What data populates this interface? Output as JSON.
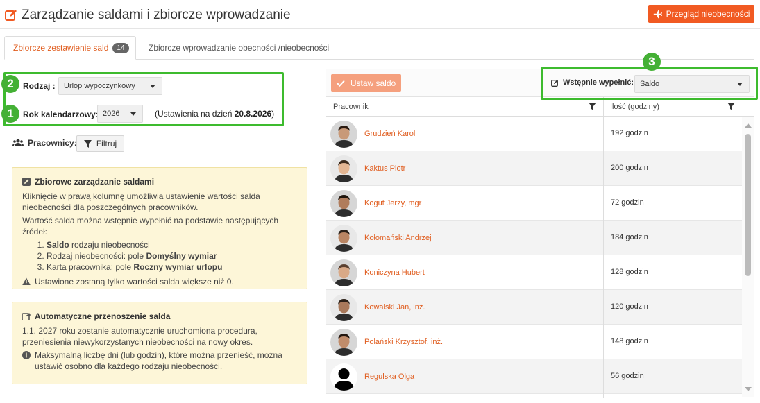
{
  "header": {
    "title": "Zarządzanie saldami i zbiorcze wprowadzanie",
    "absences_button": "Przegląd nieobecności"
  },
  "tabs": [
    {
      "label": "Zbiorcze zestawienie sald",
      "badge": "14",
      "active": true
    },
    {
      "label": "Zbiorcze wprowadzanie obecności /nieobecności",
      "active": false
    }
  ],
  "markers": [
    "1",
    "2",
    "3"
  ],
  "filters": {
    "type_label": "Rodzaj :",
    "type_value": "Urlop wypoczynkowy",
    "year_label": "Rok kalendarzowy:",
    "year_value": "2026",
    "settings_prefix": "(Ustawienia na dzień ",
    "settings_date": "20.8.2026",
    "settings_suffix": ")"
  },
  "workers": {
    "label": "Pracownicy:",
    "filter_button": "Filtruj"
  },
  "info_saldo": {
    "title": "Zbiorowe zarządzanie saldami",
    "p1": "Kliknięcie w prawą kolumnę umożliwia ustawienie wartości salda nieobecności dla poszczególnych pracowników.",
    "p2": "Wartość salda można wstępnie wypełnić na podstawie następujących źródeł:",
    "items": [
      {
        "bold": "Saldo",
        "pre": "",
        "post": " rodzaju nieobecności"
      },
      {
        "pre": "Rodzaj nieobecności: pole ",
        "bold": "Domyślny wymiar",
        "post": ""
      },
      {
        "pre": "Karta pracownika: pole ",
        "bold": "Roczny wymiar urlopu",
        "post": ""
      }
    ],
    "warning": "Ustawione zostaną tylko wartości salda większe niż 0."
  },
  "info_transfer": {
    "title": "Automatyczne przenoszenie salda",
    "p1": "1.1. 2027 roku zostanie automatycznie uruchomiona procedura, przeniesienia niewykorzystanych nieobecności na nowy okres.",
    "note": "Maksymalną liczbę dni (lub godzin), które można przenieść, można ustawić osobno dla każdego rodzaju nieobecności."
  },
  "panel": {
    "set_saldo_button": "Ustaw saldo",
    "prefill_label": "Wstępnie wypełnić:",
    "prefill_value": "Saldo",
    "col_worker": "Pracownik",
    "col_hours": "Ilość (godziny)"
  },
  "employees": [
    {
      "name": "Grudzień Karol",
      "hours": "192 godzin"
    },
    {
      "name": "Kaktus Piotr",
      "hours": "200 godzin"
    },
    {
      "name": "Kogut Jerzy, mgr",
      "hours": "72 godzin"
    },
    {
      "name": "Kołomański Andrzej",
      "hours": "184 godzin"
    },
    {
      "name": "Koniczyna Hubert",
      "hours": "128 godzin"
    },
    {
      "name": "Kowalski Jan, inż.",
      "hours": "120 godzin"
    },
    {
      "name": "Polański Krzysztof, inż.",
      "hours": "148 godzin"
    },
    {
      "name": "Regulska Olga",
      "hours": "56 godzin"
    }
  ],
  "colors": {
    "accent": "#f15a22",
    "link": "#e05d1f",
    "highlight_green": "#3dbb2e",
    "info_bg": "#fdf6d8"
  }
}
